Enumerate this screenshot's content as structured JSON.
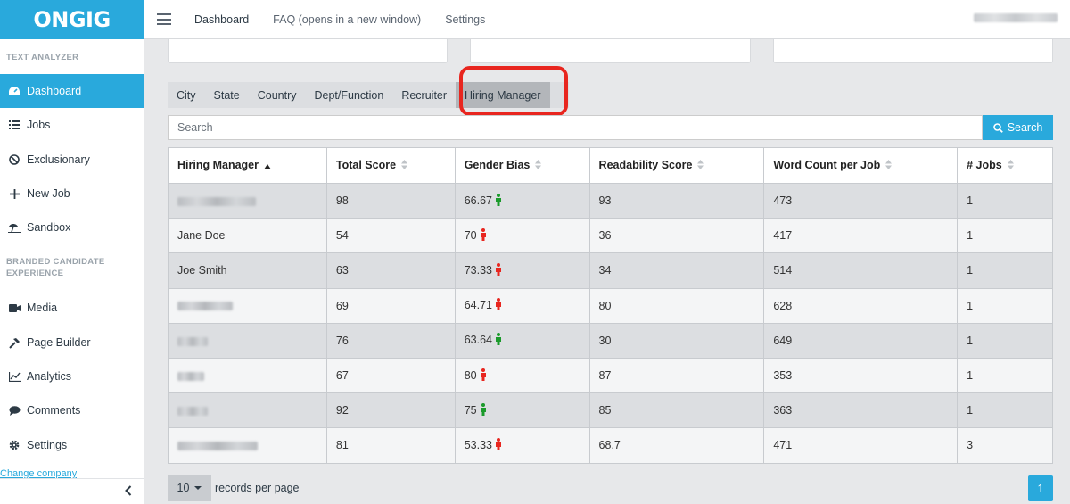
{
  "app": {
    "logo_text": "ONGIG",
    "brand_color": "#29a9dc"
  },
  "topbar": {
    "nav": [
      {
        "label": "Dashboard"
      },
      {
        "label": "FAQ (opens in a new window)"
      },
      {
        "label": "Settings"
      }
    ]
  },
  "sidebar": {
    "section_text_analyzer": "TEXT ANALYZER",
    "section_branded": "BRANDED CANDIDATE EXPERIENCE",
    "items": [
      {
        "label": "Dashboard",
        "icon": "dashboard-icon",
        "active": true
      },
      {
        "label": "Jobs",
        "icon": "list-icon"
      },
      {
        "label": "Exclusionary",
        "icon": "ban-icon"
      },
      {
        "label": "New Job",
        "icon": "plus-icon"
      },
      {
        "label": "Sandbox",
        "icon": "sandbox-icon"
      },
      {
        "label": "Media",
        "icon": "video-icon"
      },
      {
        "label": "Page Builder",
        "icon": "hammer-icon"
      },
      {
        "label": "Analytics",
        "icon": "chart-icon"
      },
      {
        "label": "Comments",
        "icon": "comment-icon"
      },
      {
        "label": "Settings",
        "icon": "gear-icon"
      }
    ],
    "change_company": "Change company",
    "collapse_icon": "chevron-left-icon"
  },
  "filter_tabs": [
    {
      "label": "City"
    },
    {
      "label": "State"
    },
    {
      "label": "Country"
    },
    {
      "label": "Dept/Function"
    },
    {
      "label": "Recruiter"
    },
    {
      "label": "Hiring Manager",
      "active": true
    }
  ],
  "search": {
    "placeholder": "Search",
    "button_label": "Search"
  },
  "table": {
    "columns": [
      "Hiring Manager",
      "Total Score",
      "Gender Bias",
      "Readability Score",
      "Word Count per Job",
      "# Jobs"
    ],
    "rows": [
      {
        "name": "",
        "total": "98",
        "gender": "66.67",
        "gender_icon": "neutral-person-icon",
        "readability": "93",
        "words": "473",
        "jobs": "1"
      },
      {
        "name": "Jane Doe",
        "total": "54",
        "gender": "70",
        "gender_icon": "biased-person-icon",
        "readability": "36",
        "words": "417",
        "jobs": "1"
      },
      {
        "name": "Joe Smith",
        "total": "63",
        "gender": "73.33",
        "gender_icon": "biased-person-icon",
        "readability": "34",
        "words": "514",
        "jobs": "1"
      },
      {
        "name": "",
        "total": "69",
        "gender": "64.71",
        "gender_icon": "biased-person-icon",
        "readability": "80",
        "words": "628",
        "jobs": "1"
      },
      {
        "name": "",
        "total": "76",
        "gender": "63.64",
        "gender_icon": "neutral-person-icon",
        "readability": "30",
        "words": "649",
        "jobs": "1"
      },
      {
        "name": "",
        "total": "67",
        "gender": "80",
        "gender_icon": "biased-person-icon",
        "readability": "87",
        "words": "353",
        "jobs": "1"
      },
      {
        "name": "",
        "total": "92",
        "gender": "75",
        "gender_icon": "neutral-person-icon",
        "readability": "85",
        "words": "363",
        "jobs": "1"
      },
      {
        "name": "",
        "total": "81",
        "gender": "53.33",
        "gender_icon": "biased-person-icon",
        "readability": "68.7",
        "words": "471",
        "jobs": "3"
      }
    ],
    "gender_colors": {
      "neutral": "#1a9a2a",
      "biased": "#e8261f"
    }
  },
  "pagination": {
    "page_size": "10",
    "page_size_label": "records per page",
    "current_page": "1"
  },
  "highlight_color": "#e8261f"
}
